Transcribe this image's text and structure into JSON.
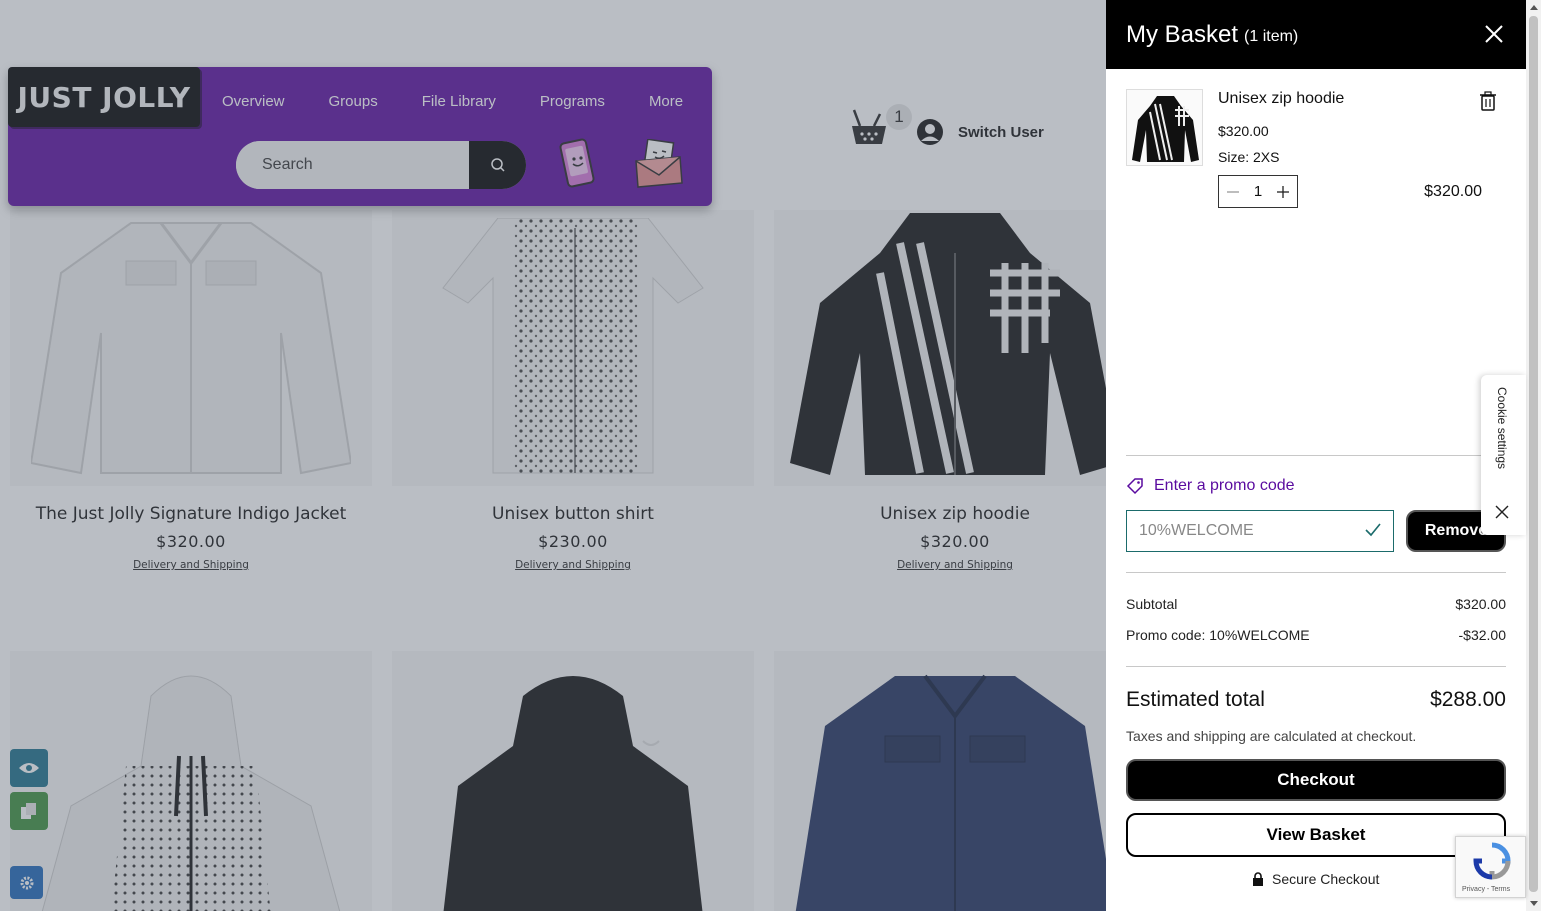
{
  "brand": {
    "logo_text": "JUST JOLLY",
    "accent": "#5a0b9f"
  },
  "nav": {
    "items": [
      "Overview",
      "Groups",
      "File Library",
      "Programs",
      "More"
    ]
  },
  "search": {
    "placeholder": "Search"
  },
  "cart": {
    "count": "1"
  },
  "user": {
    "switch_label": "Switch User"
  },
  "products": [
    {
      "name": "The Just Jolly Signature Indigo Jacket",
      "price": "$320.00",
      "delivery": "Delivery and Shipping"
    },
    {
      "name": "Unisex button shirt",
      "price": "$230.00",
      "delivery": "Delivery and Shipping"
    },
    {
      "name": "Unisex zip hoodie",
      "price": "$320.00",
      "delivery": "Delivery and Shipping"
    }
  ],
  "basket": {
    "title": "My Basket",
    "count_label": "(1 item)",
    "item": {
      "name": "Unisex zip hoodie",
      "price": "$320.00",
      "size": "Size: 2XS",
      "quantity": "1",
      "line_total": "$320.00"
    },
    "promo": {
      "link_label": "Enter a promo code",
      "value": "10%WELCOME",
      "remove_label": "Remove"
    },
    "summary": {
      "subtotal_label": "Subtotal",
      "subtotal_value": "$320.00",
      "promo_label": "Promo code: 10%WELCOME",
      "promo_value": "-$32.00",
      "estimated_label": "Estimated total",
      "estimated_value": "$288.00",
      "tax_note": "Taxes and shipping are calculated at checkout."
    },
    "checkout_label": "Checkout",
    "view_basket_label": "View Basket",
    "secure_label": "Secure Checkout"
  },
  "cookie": {
    "label": "Cookie settings"
  },
  "recaptcha": {
    "label": "Privacy - Terms"
  }
}
